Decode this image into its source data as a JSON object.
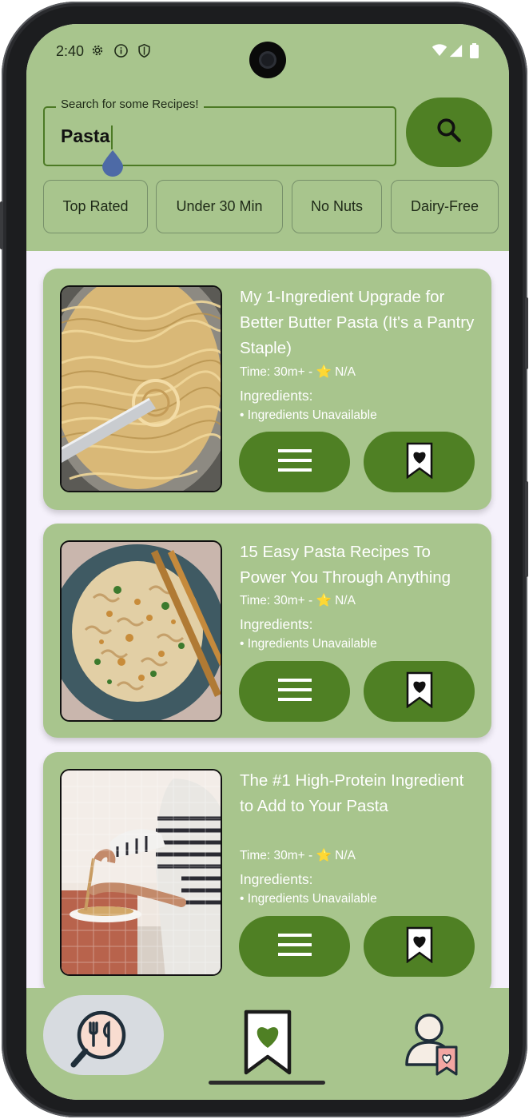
{
  "status_bar": {
    "time": "2:40",
    "left_icons": [
      "settings-icon",
      "info-icon",
      "shield-icon"
    ],
    "right_icons": [
      "wifi-icon",
      "cell-signal-icon",
      "battery-icon"
    ]
  },
  "search": {
    "label": "Search for some Recipes!",
    "value": "Pasta",
    "button_icon": "search-icon"
  },
  "filters": [
    "Top Rated",
    "Under 30 Min",
    "No Nuts",
    "Dairy-Free"
  ],
  "recipes": [
    {
      "title": "My 1-Ingredient Upgrade for Better Butter Pasta (It's a Pantry Staple)",
      "time_rating": "Time: 30m+ - ⭐ N/A",
      "ingredients_heading": "Ingredients:",
      "ingredients": "• Ingredients Unavailable",
      "image": "butter-spaghetti-in-pan"
    },
    {
      "title": "15 Easy Pasta Recipes To Power You Through Anything",
      "time_rating": "Time: 30m+ - ⭐ N/A",
      "ingredients_heading": "Ingredients:",
      "ingredients": "• Ingredients Unavailable",
      "image": "fusilli-with-breadcrumbs"
    },
    {
      "title": "The #1 High-Protein Ingredient to Add to Your Pasta",
      "time_rating": "Time: 30m+ - ⭐ N/A",
      "ingredients_heading": "Ingredients:",
      "ingredients": "• Ingredients Unavailable",
      "image": "person-serving-pasta"
    }
  ],
  "card_actions": {
    "details_icon": "menu-icon",
    "save_icon": "bookmark-heart-icon"
  },
  "bottom_nav": [
    {
      "icon": "recipe-search-icon",
      "active": true
    },
    {
      "icon": "favorites-bookmark-icon",
      "active": false
    },
    {
      "icon": "profile-icon",
      "active": false
    }
  ],
  "colors": {
    "header": "#a8c58d",
    "accent": "#4f8024",
    "screen_bg": "#f5f1fb",
    "card_text": "#ffffff"
  }
}
